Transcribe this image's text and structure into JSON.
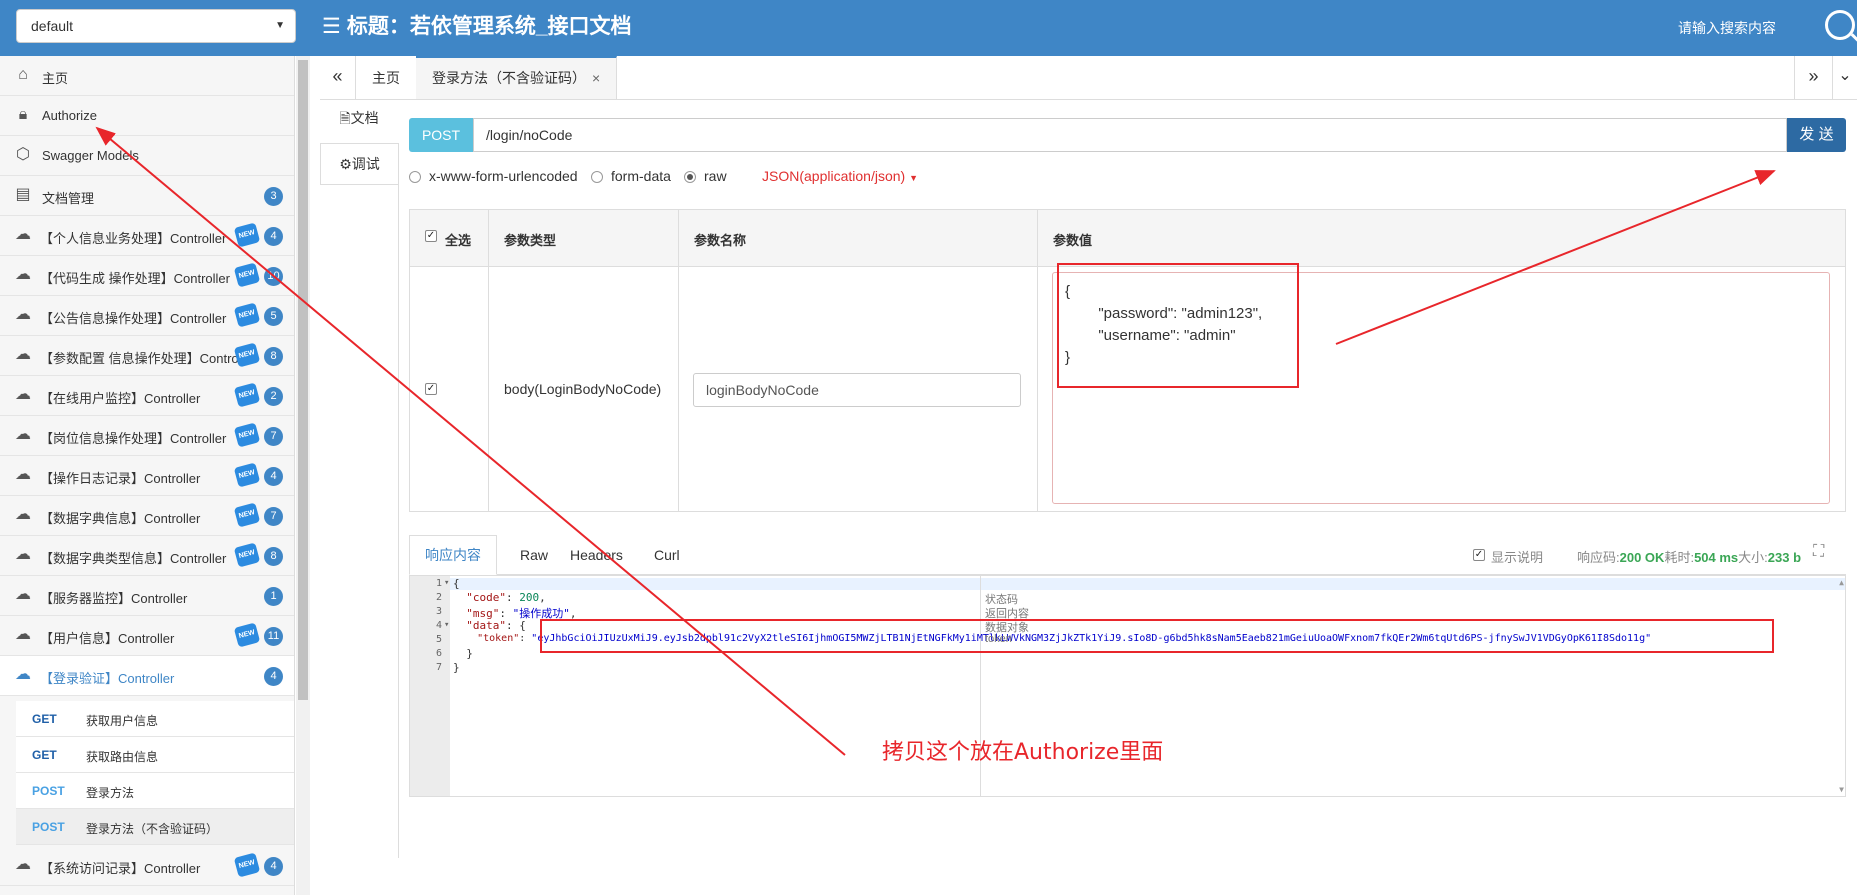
{
  "header": {
    "group_select": "default",
    "title": "标题：若依管理系统_接口文档",
    "search_placeholder": "请输入搜索内容"
  },
  "sidebar": {
    "items": [
      {
        "label": "主页",
        "icon": "home-icon"
      },
      {
        "label": "Authorize",
        "icon": "lock-icon"
      },
      {
        "label": "Swagger Models",
        "icon": "cube-icon"
      },
      {
        "label": "文档管理",
        "icon": "doc-settings-icon",
        "badge": "3"
      },
      {
        "label": "【个人信息业务处理】Controller",
        "badge": "4",
        "new": true
      },
      {
        "label": "【代码生成 操作处理】Controller",
        "badge": "10",
        "new": true
      },
      {
        "label": "【公告信息操作处理】Controller",
        "badge": "5",
        "new": true
      },
      {
        "label": "【参数配置 信息操作处理】Controller",
        "badge": "8",
        "new": true
      },
      {
        "label": "【在线用户监控】Controller",
        "badge": "2",
        "new": true
      },
      {
        "label": "【岗位信息操作处理】Controller",
        "badge": "7",
        "new": true
      },
      {
        "label": "【操作日志记录】Controller",
        "badge": "4",
        "new": true
      },
      {
        "label": "【数据字典信息】Controller",
        "badge": "7",
        "new": true
      },
      {
        "label": "【数据字典类型信息】Controller",
        "badge": "8",
        "new": true
      },
      {
        "label": "【服务器监控】Controller",
        "badge": "1",
        "new": false
      },
      {
        "label": "【用户信息】Controller",
        "badge": "11",
        "new": true
      },
      {
        "label": "【登录验证】Controller",
        "badge": "4",
        "new": false
      }
    ],
    "sub_items": [
      {
        "method": "GET",
        "label": "获取用户信息"
      },
      {
        "method": "GET",
        "label": "获取路由信息"
      },
      {
        "method": "POST",
        "label": "登录方法"
      },
      {
        "method": "POST",
        "label": "登录方法（不含验证码）"
      }
    ],
    "last_item": {
      "label": "【系统访问记录】Controller",
      "badge": "4",
      "new": true
    },
    "new_label": "NEW"
  },
  "tabs": {
    "left_arrow": "«",
    "right_arrow": "»",
    "down_arrow": "⌄",
    "items": [
      {
        "label": "主页"
      },
      {
        "label": "登录方法（不含验证码）",
        "close": "×"
      }
    ]
  },
  "side_tabs": {
    "doc": "文档",
    "debug": "调试"
  },
  "request": {
    "method": "POST",
    "url": "/login/noCode",
    "send": "发 送",
    "body_types": [
      "x-www-form-urlencoded",
      "form-data",
      "raw"
    ],
    "selected_body_type": "raw",
    "content_type": "JSON(application/json)"
  },
  "params_table": {
    "headers": {
      "select_all": "全选",
      "type": "参数类型",
      "name": "参数名称",
      "value": "参数值"
    },
    "row": {
      "checked": true,
      "type": "body(LoginBodyNoCode)",
      "name": "loginBodyNoCode",
      "value": "{\n        \"password\": \"admin123\",\n        \"username\": \"admin\"\n}"
    }
  },
  "response": {
    "tabs": [
      "响应内容",
      "Raw",
      "Headers",
      "Curl"
    ],
    "show_desc": "显示说明",
    "status_label": "响应码:",
    "status_value": "200 OK",
    "time_label": "耗时:",
    "time_value": "504 ms",
    "size_label": "大小:",
    "size_value": "233 b",
    "line_numbers": [
      "1",
      "2",
      "3",
      "4",
      "5",
      "6",
      "7"
    ],
    "code": {
      "l1": "{",
      "l2_key": "\"code\"",
      "l2_val": "200",
      "l3_key": "\"msg\"",
      "l3_val": "\"操作成功\"",
      "l4_key": "\"data\"",
      "l5_key": "\"token\"",
      "l5_val": "\"eyJhbGciOiJIUzUxMiJ9.eyJsb2dpbl91c2VyX2tleSI6IjhmOGI5MWZjLTB1NjEtNGFkMy1iMTlkLWVkNGM3ZjJkZTk1YiJ9.sIo8D-g6bd5hk8sNam5Eaeb821mGeiuUoaOWFxnom7fkQEr2Wm6tqUtd6PS-jfnySwJV1VDGyOpK61I8Sdo11g\"",
      "l6": "}",
      "l7": "}"
    },
    "comments": [
      "状态码",
      "返回内容",
      "数据对象",
      "token"
    ]
  },
  "annotation": {
    "text": "拷贝这个放在Authorize里面",
    "color": "#e8262b"
  }
}
